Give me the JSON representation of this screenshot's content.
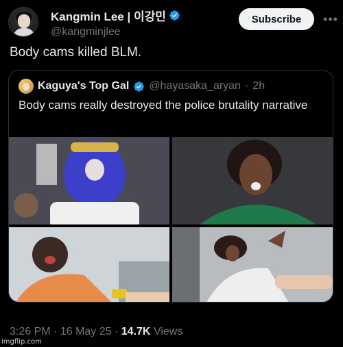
{
  "author": {
    "display_name": "Kangmin Lee | 이강민",
    "handle": "@kangminjlee",
    "verified": true
  },
  "subscribe_label": "Subscribe",
  "more_label": "•••",
  "tweet_text": "Body cams killed BLM.",
  "quoted": {
    "display_name": "Kaguya's Top Gal",
    "handle": "@hayasaka_aryan",
    "separator": "·",
    "time": "2h",
    "verified": true,
    "text": "Body cams really destroyed the police brutality narrative"
  },
  "footer": {
    "time": "3:26 PM",
    "date": "16 May 25",
    "separator": "·",
    "views_count": "14.7K",
    "views_label": "Views"
  },
  "watermark": "imgflip.com",
  "colors": {
    "background": "#000000",
    "text_primary": "#e7e9ea",
    "text_secondary": "#71767b",
    "verified_blue": "#1d9bf0",
    "border": "#2f3336"
  },
  "icons": {
    "verified": "verified-badge-icon",
    "more": "more-horizontal-icon"
  }
}
